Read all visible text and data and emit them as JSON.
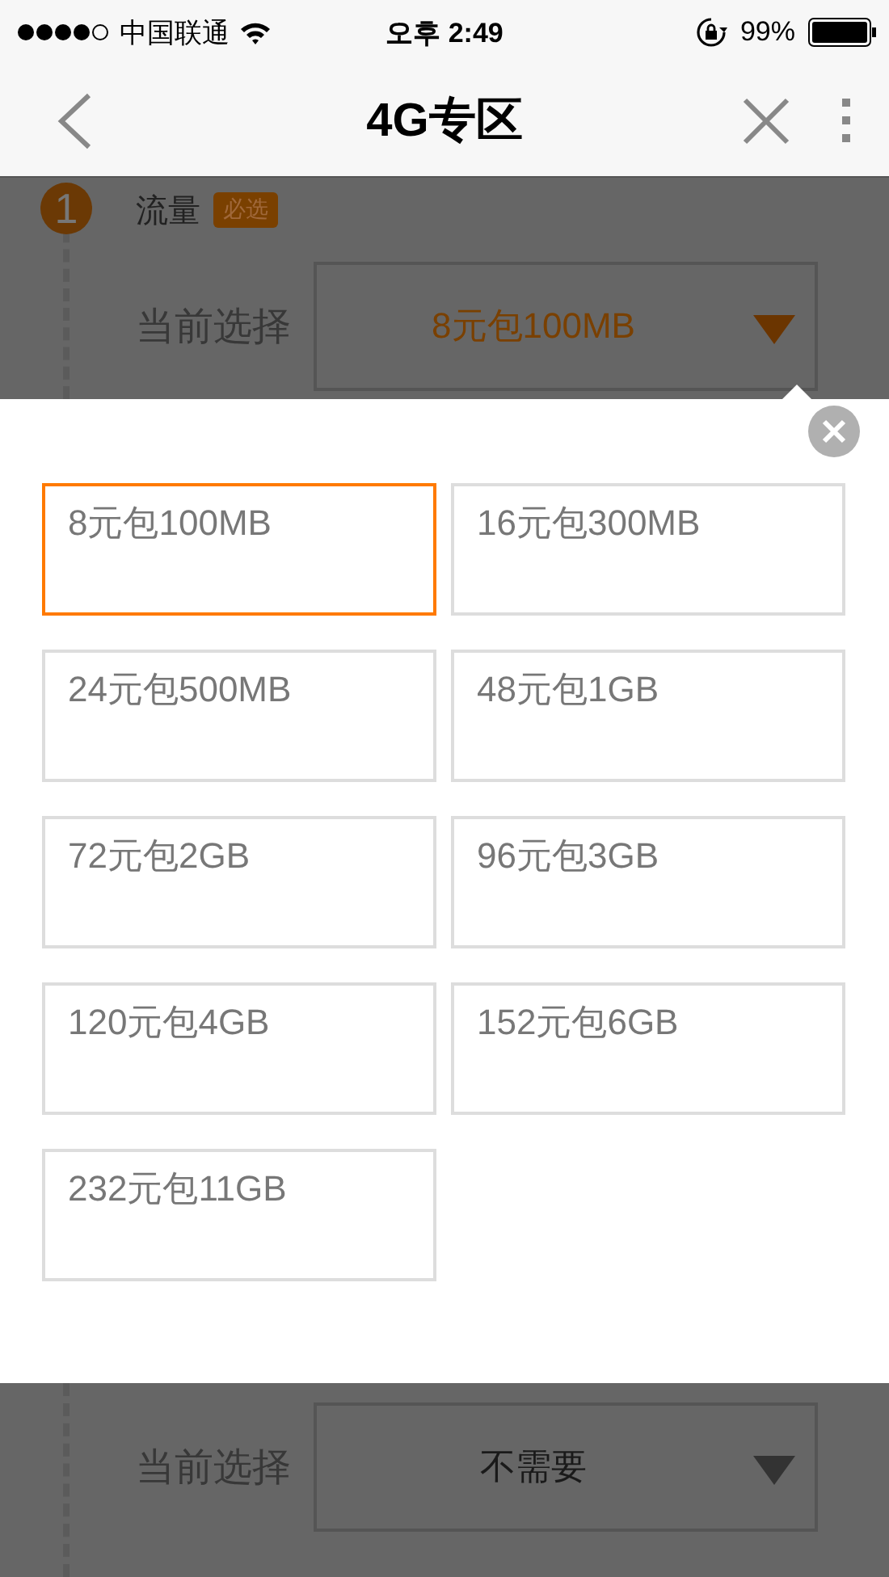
{
  "status_bar": {
    "carrier": "中国联通",
    "time": "오후 2:49",
    "battery": "99%"
  },
  "header": {
    "title": "4G专区"
  },
  "step": {
    "number": "1",
    "title": "流量",
    "badge": "必选",
    "label": "当前选择",
    "value": "8元包100MB"
  },
  "sheet": {
    "options": [
      {
        "label": "8元包100MB",
        "selected": true
      },
      {
        "label": "16元包300MB",
        "selected": false
      },
      {
        "label": "24元包500MB",
        "selected": false
      },
      {
        "label": "48元包1GB",
        "selected": false
      },
      {
        "label": "72元包2GB",
        "selected": false
      },
      {
        "label": "96元包3GB",
        "selected": false
      },
      {
        "label": "120元包4GB",
        "selected": false
      },
      {
        "label": "152元包6GB",
        "selected": false
      },
      {
        "label": "232元包11GB",
        "selected": false
      }
    ]
  },
  "next_step": {
    "label": "当前选择",
    "value": "不需要"
  }
}
